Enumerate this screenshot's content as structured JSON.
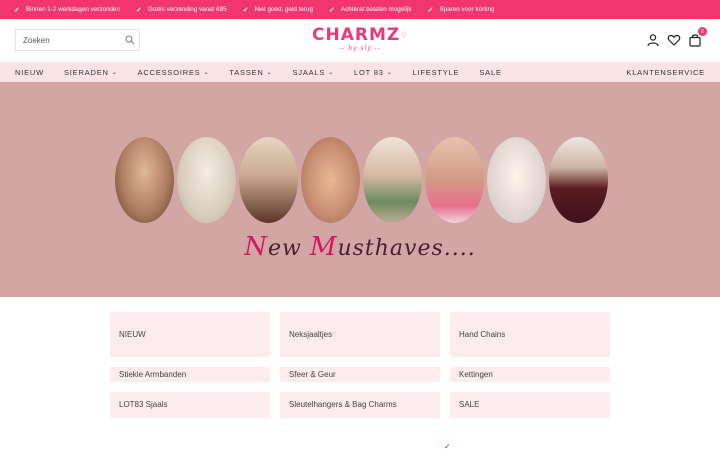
{
  "topbar": {
    "usps": [
      "Binnen 1-2 werkdagen verzonden",
      "Gratis verzending vanaf €85",
      "Niet goed, geld terug",
      "Achteraf betalen mogelijk",
      "Sparen voor korting"
    ],
    "check_icon": "check-icon",
    "accent_color": "#f0356f"
  },
  "header": {
    "search_placeholder": "Zoeken",
    "logo_text": "CHARMZ",
    "logo_sub": "-- by sly --",
    "cart_count": "0"
  },
  "nav": {
    "items": [
      {
        "label": "NIEUW",
        "dropdown": false
      },
      {
        "label": "SIERADEN",
        "dropdown": true
      },
      {
        "label": "ACCESSOIRES",
        "dropdown": true
      },
      {
        "label": "TASSEN",
        "dropdown": true
      },
      {
        "label": "SJAALS",
        "dropdown": true
      },
      {
        "label": "LOT 83",
        "dropdown": true
      },
      {
        "label": "LIFESTYLE",
        "dropdown": false
      },
      {
        "label": "SALE",
        "dropdown": false
      }
    ],
    "service": "KLANTENSERVICE",
    "background": "#fce3e6"
  },
  "hero": {
    "title_accent_1": "N",
    "title_part_1": "ew ",
    "title_accent_2": "M",
    "title_part_2": "usthaves....",
    "background": "#d3a6a6"
  },
  "categories": [
    "NIEUW",
    "Neksjaaltjes",
    "Hand Chains",
    "Stiekie Armbanden",
    "Sfeer & Geur",
    "Kettingen",
    "LOT83 Sjaals",
    "Sleutelhangers & Bag Charms",
    "SALE"
  ]
}
